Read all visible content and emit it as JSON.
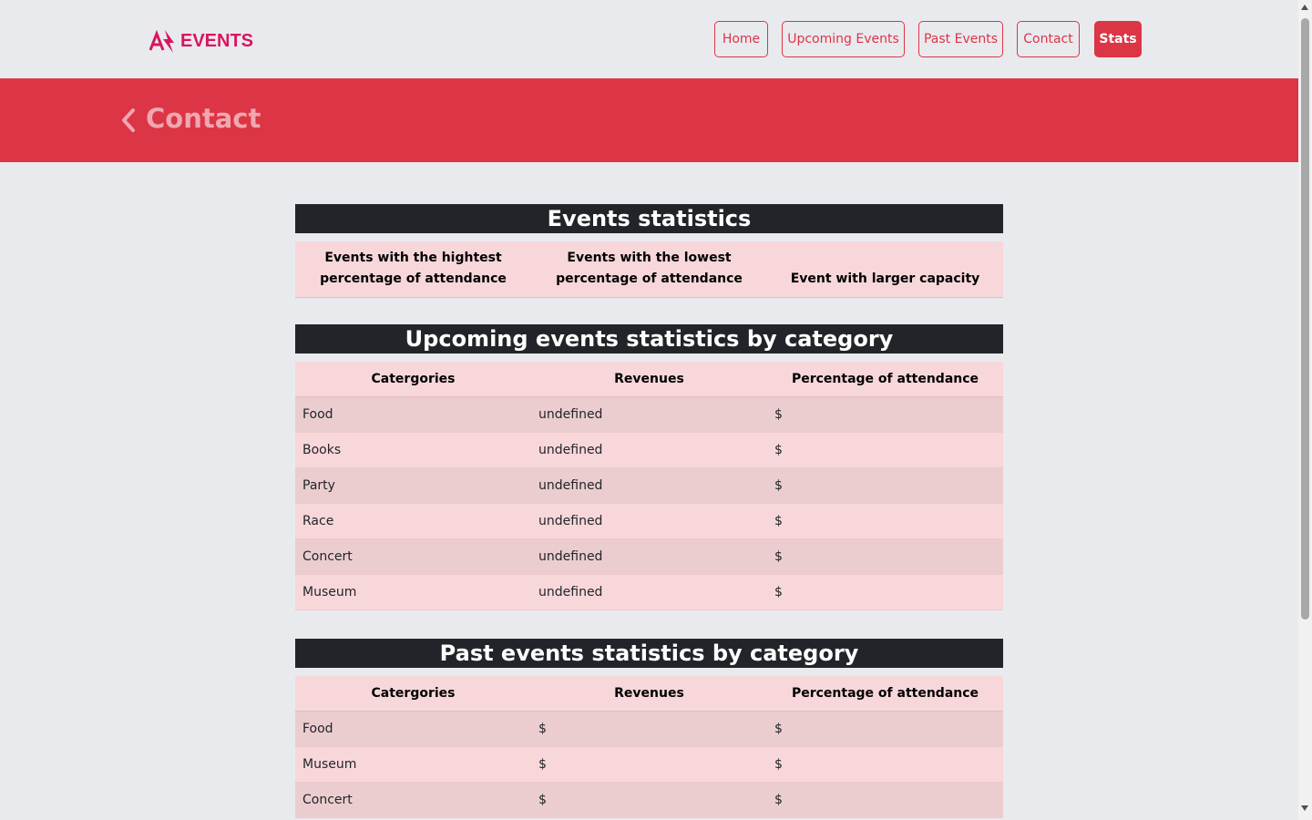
{
  "header": {
    "logo_text": "EVENTS",
    "nav": [
      {
        "label": "Home",
        "active": false
      },
      {
        "label": "Upcoming Events",
        "active": false
      },
      {
        "label": "Past Events",
        "active": false
      },
      {
        "label": "Contact",
        "active": false
      },
      {
        "label": "Stats",
        "active": true
      }
    ]
  },
  "banner": {
    "title": "Contact"
  },
  "events_statistics": {
    "title": "Events statistics",
    "columns": [
      "Events with the hightest percentage of attendance",
      "Events with the lowest percentage of attendance",
      "Event with larger capacity"
    ]
  },
  "upcoming_statistics": {
    "title": "Upcoming events statistics by category",
    "columns": [
      "Catergories",
      "Revenues",
      "Percentage of attendance"
    ],
    "rows": [
      [
        "Food",
        "undefined",
        "$"
      ],
      [
        "Books",
        "undefined",
        "$"
      ],
      [
        "Party",
        "undefined",
        "$"
      ],
      [
        "Race",
        "undefined",
        "$"
      ],
      [
        "Concert",
        "undefined",
        "$"
      ],
      [
        "Museum",
        "undefined",
        "$"
      ]
    ]
  },
  "past_statistics": {
    "title": "Past events statistics by category",
    "columns": [
      "Catergories",
      "Revenues",
      "Percentage of attendance"
    ],
    "rows": [
      [
        "Food",
        "$",
        "$"
      ],
      [
        "Museum",
        "$",
        "$"
      ],
      [
        "Concert",
        "$",
        "$"
      ]
    ]
  },
  "colors": {
    "accent": "#dc3545",
    "logo": "#d6165e",
    "page_bg": "#e9eaee",
    "table_header_bg": "#212529",
    "table_row_light": "#f8d7da",
    "table_row_dark": "#ebcdd0"
  }
}
